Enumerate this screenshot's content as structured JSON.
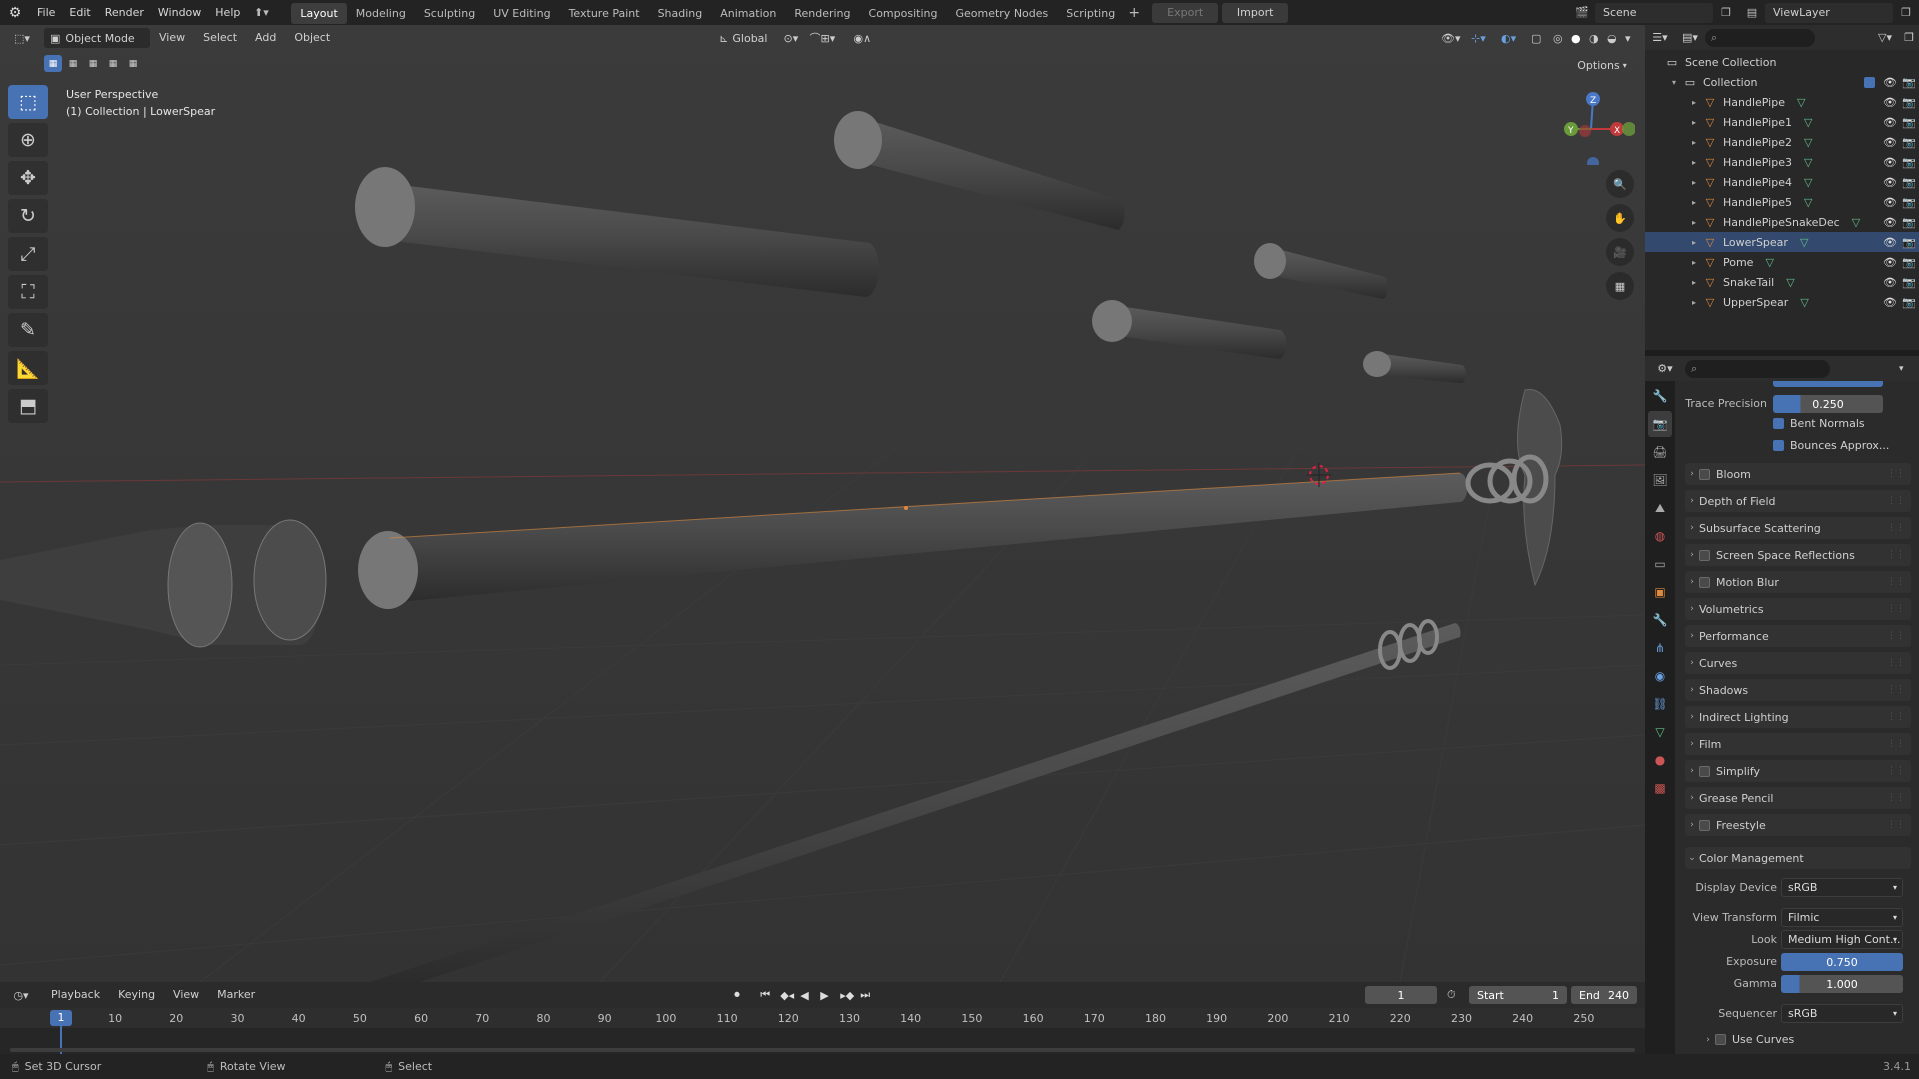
{
  "topbar": {
    "menus": [
      "File",
      "Edit",
      "Render",
      "Window",
      "Help"
    ],
    "workspaces": [
      "Layout",
      "Modeling",
      "Sculpting",
      "UV Editing",
      "Texture Paint",
      "Shading",
      "Animation",
      "Rendering",
      "Compositing",
      "Geometry Nodes",
      "Scripting"
    ],
    "active_workspace": "Layout",
    "export_label": "Export",
    "import_label": "Import",
    "scene_name": "Scene",
    "view_layer": "ViewLayer"
  },
  "viewport_header": {
    "mode": "Object Mode",
    "menus": [
      "View",
      "Select",
      "Add",
      "Object"
    ],
    "transform_orientation": "Global",
    "options_label": "Options"
  },
  "viewport": {
    "perspective_label": "User Perspective",
    "context_label": "(1) Collection | LowerSpear",
    "gizmo_axes": [
      "Z",
      "Y",
      "X"
    ]
  },
  "outliner": {
    "root": "Scene Collection",
    "collection": "Collection",
    "objects": [
      "HandlePipe",
      "HandlePipe1",
      "HandlePipe2",
      "HandlePipe3",
      "HandlePipe4",
      "HandlePipe5",
      "HandlePipeSnakeDec",
      "LowerSpear",
      "Pome",
      "SnakeTail",
      "UpperSpear"
    ],
    "selected_object": "LowerSpear"
  },
  "properties": {
    "trace_precision_label": "Trace Precision",
    "trace_precision_value": "0.250",
    "trace_precision_fraction": 0.25,
    "bent_normals_label": "Bent Normals",
    "bounces_label": "Bounces Approx...",
    "panels": [
      {
        "label": "Bloom",
        "checkbox": true
      },
      {
        "label": "Depth of Field",
        "checkbox": false
      },
      {
        "label": "Subsurface Scattering",
        "checkbox": false
      },
      {
        "label": "Screen Space Reflections",
        "checkbox": true
      },
      {
        "label": "Motion Blur",
        "checkbox": true
      },
      {
        "label": "Volumetrics",
        "checkbox": false
      },
      {
        "label": "Performance",
        "checkbox": false
      },
      {
        "label": "Curves",
        "checkbox": false
      },
      {
        "label": "Shadows",
        "checkbox": false
      },
      {
        "label": "Indirect Lighting",
        "checkbox": false
      },
      {
        "label": "Film",
        "checkbox": false
      },
      {
        "label": "Simplify",
        "checkbox": true
      },
      {
        "label": "Grease Pencil",
        "checkbox": false
      },
      {
        "label": "Freestyle",
        "checkbox": true
      }
    ],
    "color_management": {
      "label": "Color Management",
      "display_device_label": "Display Device",
      "display_device": "sRGB",
      "view_transform_label": "View Transform",
      "view_transform": "Filmic",
      "look_label": "Look",
      "look": "Medium High Cont...",
      "exposure_label": "Exposure",
      "exposure": "0.750",
      "gamma_label": "Gamma",
      "gamma": "1.000",
      "sequencer_label": "Sequencer",
      "sequencer": "sRGB",
      "use_curves_label": "Use Curves"
    }
  },
  "timeline": {
    "menus": [
      "Playback",
      "Keying",
      "View",
      "Marker"
    ],
    "current_frame": "1",
    "start_label": "Start",
    "start": "1",
    "end_label": "End",
    "end": "240",
    "ticks": [
      "1",
      "10",
      "20",
      "30",
      "40",
      "50",
      "60",
      "70",
      "80",
      "90",
      "100",
      "110",
      "120",
      "130",
      "140",
      "150",
      "160",
      "170",
      "180",
      "190",
      "200",
      "210",
      "220",
      "230",
      "240",
      "250"
    ]
  },
  "statusbar": {
    "items": [
      "Set 3D Cursor",
      "Rotate View",
      "Select"
    ],
    "version": "3.4.1"
  },
  "colors": {
    "accent": "#4772b3",
    "selected_row": "#334a6e",
    "frame_marker": "#4772b3",
    "object_orange": "#e08a3c",
    "mesh_green": "#5fc08a"
  }
}
